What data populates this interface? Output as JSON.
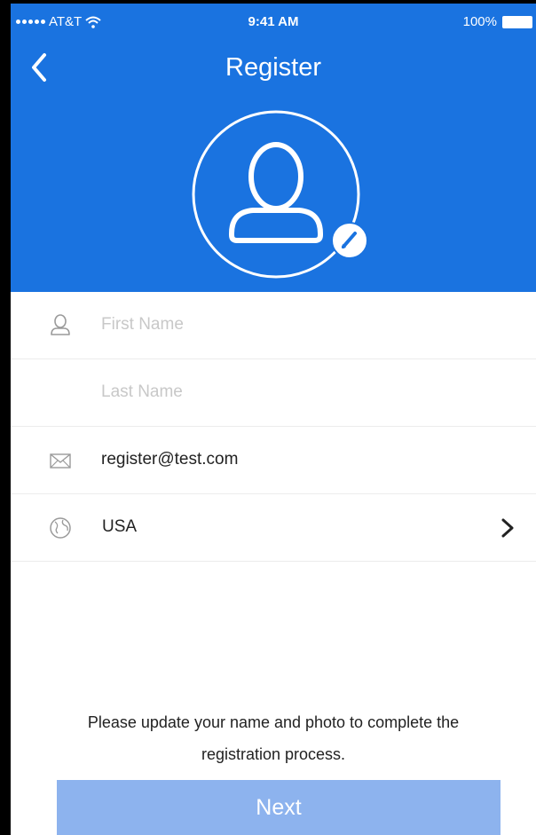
{
  "status_bar": {
    "carrier": "AT&T",
    "time": "9:41 AM",
    "battery": "100%"
  },
  "header": {
    "title": "Register"
  },
  "form": {
    "first_name": {
      "placeholder": "First Name",
      "value": ""
    },
    "last_name": {
      "placeholder": "Last Name",
      "value": ""
    },
    "email": {
      "value": "register@test.com"
    },
    "country": {
      "value": "USA"
    }
  },
  "message": "Please update your name and photo to complete the registration process.",
  "next_label": "Next",
  "colors": {
    "header_bg": "#1a73e0",
    "button_bg": "#8db3ee",
    "placeholder": "#c8c8c8"
  },
  "icons": {
    "back": "chevron-left-icon",
    "avatar": "user-icon",
    "edit": "pencil-icon",
    "name": "person-icon",
    "email": "envelope-icon",
    "country": "globe-icon",
    "select": "chevron-right-icon"
  }
}
